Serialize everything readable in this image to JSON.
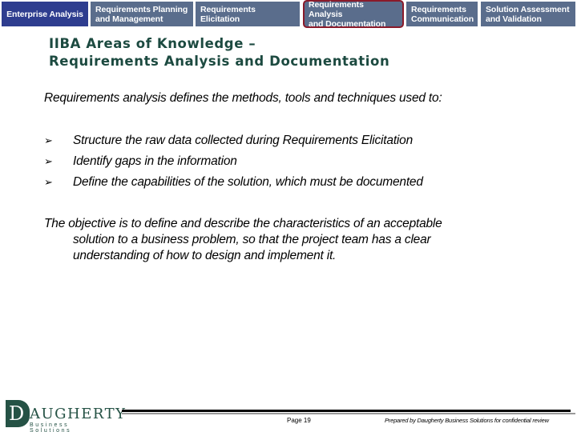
{
  "nav_tabs": [
    {
      "line1": "Enterprise Analysis",
      "line2": ""
    },
    {
      "line1": "Requirements Planning",
      "line2": "and Management"
    },
    {
      "line1": "Requirements Elicitation",
      "line2": ""
    },
    {
      "line1": "Requirements Analysis",
      "line2": "and Documentation"
    },
    {
      "line1": "Requirements",
      "line2": "Communication"
    },
    {
      "line1": "Solution Assessment",
      "line2": "and Validation"
    }
  ],
  "active_tab": "Requirements Analysis and Documentation",
  "title": {
    "line1": "IIBA Areas of Knowledge –",
    "line2": "Requirements Analysis and Documentation"
  },
  "intro": "Requirements analysis defines the methods, tools and techniques used to:",
  "bullet_marker": "➢",
  "bullets": [
    "Structure the raw data collected during Requirements Elicitation",
    "Identify gaps in the information",
    "Define the capabilities of the solution, which must be documented"
  ],
  "objective": {
    "line1": "The objective is to define and describe the characteristics of an acceptable",
    "line2": "solution to a business problem, so that the project team has a clear",
    "line3": "understanding of how to design and implement it."
  },
  "footer": {
    "logo_letter": "D",
    "logo_word": "AUGHERTY",
    "logo_sub": "Business Solutions",
    "page": "Page 19",
    "prepared_by": "Prepared by Daugherty Business Solutions for confidential review"
  },
  "colors": {
    "tab_default": "#5a6d8c",
    "tab_first": "#2e3d8f",
    "active_border": "#8a1a2a",
    "title": "#1c4a40",
    "logo": "#255245"
  }
}
